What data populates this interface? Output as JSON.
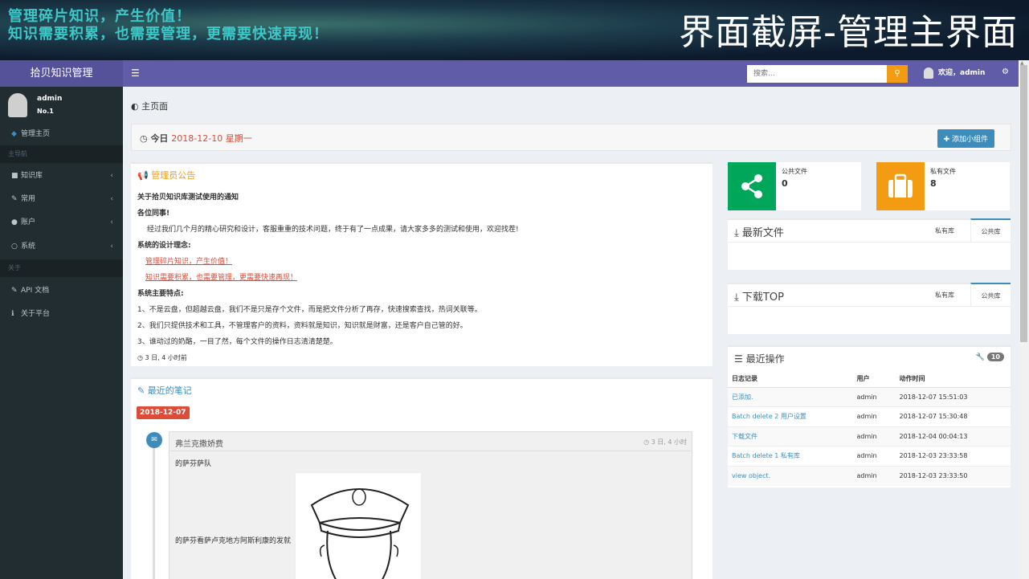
{
  "banner": {
    "line1": "管理碎片知识，产生价值！",
    "line2": "知识需要积累，也需要管理，更需要快速再现！",
    "caption": "界面截屏-管理主界面"
  },
  "topnav": {
    "logo": "拾贝知识管理",
    "search_placeholder": "搜索...",
    "welcome": "欢迎，admin",
    "menu_icon": "hamburger-icon",
    "search_icon": "search-icon",
    "cogs_icon": "cogs-icon"
  },
  "sidebar": {
    "user_name": "admin",
    "user_no": "No.1",
    "home": "管理主页",
    "header_main": "主导航",
    "items": [
      {
        "label": "知识库",
        "icon": "folder-icon"
      },
      {
        "label": "常用",
        "icon": "wrench-icon"
      },
      {
        "label": "账户",
        "icon": "user-icon"
      },
      {
        "label": "系统",
        "icon": "circle-icon"
      }
    ],
    "header_about": "关于",
    "about_items": [
      {
        "label": "API 文档",
        "icon": "wrench-icon"
      },
      {
        "label": "关于平台",
        "icon": "info-icon"
      }
    ]
  },
  "main": {
    "breadcrumb": "主页面",
    "today_label": "今日",
    "today_date": "2018-12-10 星期一",
    "add_widget": "添加小组件"
  },
  "notice": {
    "title": "管理员公告",
    "heading": "关于拾贝知识库测试使用的通知",
    "greeting": "各位同事!",
    "body": "经过我们几个月的精心研究和设计，客服重重的技术问题，终于有了一点成果，请大家多多的测试和使用，欢迎找茬!",
    "concept_title": "系统的设计理念:",
    "concept1": "管理碎片知识，产生价值！",
    "concept2": "知识需要积累，也需要管理，更需要快速再现！",
    "features_title": "系统主要特点:",
    "feature1": "1、不是云盘，但超越云盘，我们不是只是存个文件，而是把文件分析了再存，快速搜索查找，热词关联等。",
    "feature2": "2、我们只提供技术和工具，不管理客户的资料，资料就是知识，知识就是财富，还是客户自己管的好。",
    "feature3": "3、谁动过的奶酪，一目了然，每个文件的操作日志清清楚楚。",
    "time": "3 日, 4 小时前"
  },
  "notes": {
    "title": "最近的笔记",
    "date_tag": "2018-12-07",
    "item_title": "弗兰克撒娇费",
    "item_time": "3 日, 4 小时",
    "line1": "的萨芬萨队",
    "line2": "的萨芬看萨卢克地方阿斯利康的发就"
  },
  "stats": {
    "public_label": "公共文件",
    "public_value": "0",
    "private_label": "私有文件",
    "private_value": "8"
  },
  "latest_files": {
    "title": "最新文件",
    "tab1": "私有库",
    "tab2": "公共库"
  },
  "download_top": {
    "title": "下载TOP",
    "tab1": "私有库",
    "tab2": "公共库"
  },
  "recent_ops": {
    "title": "最近操作",
    "count": "10",
    "columns": [
      "日志记录",
      "用户",
      "动作时间"
    ],
    "rows": [
      {
        "log": "已添加.",
        "user": "admin",
        "time": "2018-12-07 15:51:03"
      },
      {
        "log": "Batch delete 2 用户设置",
        "user": "admin",
        "time": "2018-12-07 15:30:48"
      },
      {
        "log": "下载文件",
        "user": "admin",
        "time": "2018-12-04 00:04:13"
      },
      {
        "log": "Batch delete 1 私有库",
        "user": "admin",
        "time": "2018-12-03 23:33:58"
      },
      {
        "log": "view object.",
        "user": "admin",
        "time": "2018-12-03 23:33:50"
      }
    ]
  }
}
